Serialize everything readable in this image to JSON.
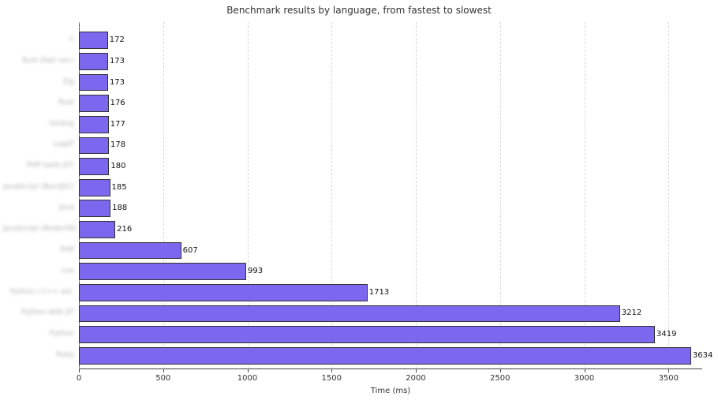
{
  "chart_data": {
    "type": "bar",
    "orientation": "horizontal",
    "title": "Benchmark results by language, from fastest to slowest",
    "xlabel": "Time (ms)",
    "ylabel": "",
    "xlim": [
      0,
      3700
    ],
    "xticks": [
      0,
      500,
      1000,
      1500,
      2000,
      2500,
      3000,
      3500
    ],
    "categories": [
      "C",
      "Rust (fast ver.)",
      "Zig",
      "Rust",
      "Golang",
      "LuaJIT",
      "PHP (with JIT)",
      "JavaScript (Bun/JSC)",
      "Java",
      "JavaScript (Node/V8)",
      "PHP",
      "Lua",
      "Python / C++ ext.",
      "Python with JIT",
      "Python",
      "Ruby"
    ],
    "values": [
      172,
      173,
      173,
      176,
      177,
      178,
      180,
      185,
      188,
      216,
      607,
      993,
      1713,
      3212,
      3419,
      3634
    ],
    "bar_color": "#7b68ee",
    "grid": true
  }
}
